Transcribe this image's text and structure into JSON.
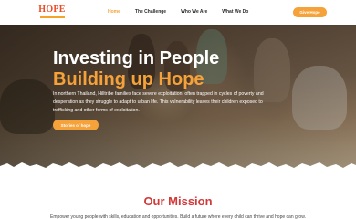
{
  "brand": {
    "logo_text": "HOPE",
    "accent": "#f5a23a",
    "logo_color": "#e84b25"
  },
  "nav": {
    "items": [
      {
        "label": "Home",
        "active": true
      },
      {
        "label": "The Challenge",
        "active": false
      },
      {
        "label": "Who We Are",
        "active": false
      },
      {
        "label": "What We Do",
        "active": false
      }
    ],
    "cta_label": "Give Hope"
  },
  "hero": {
    "title_line1": "Investing in People",
    "title_line2": "Building up Hope",
    "description": "In northern Thailand, Hilltribe families face severe exploitation, often trapped in cycles of poverty and desperation as they struggle to adapt to urban life. This vulnerability leaves their children exposed to trafficking and other forms of exploitation.",
    "button_label": "Stories of hope"
  },
  "mission": {
    "title": "Our Mission",
    "text": "Empower young people with skills, education and opportunities. Build a future where every child can thrive and hope can grow."
  }
}
